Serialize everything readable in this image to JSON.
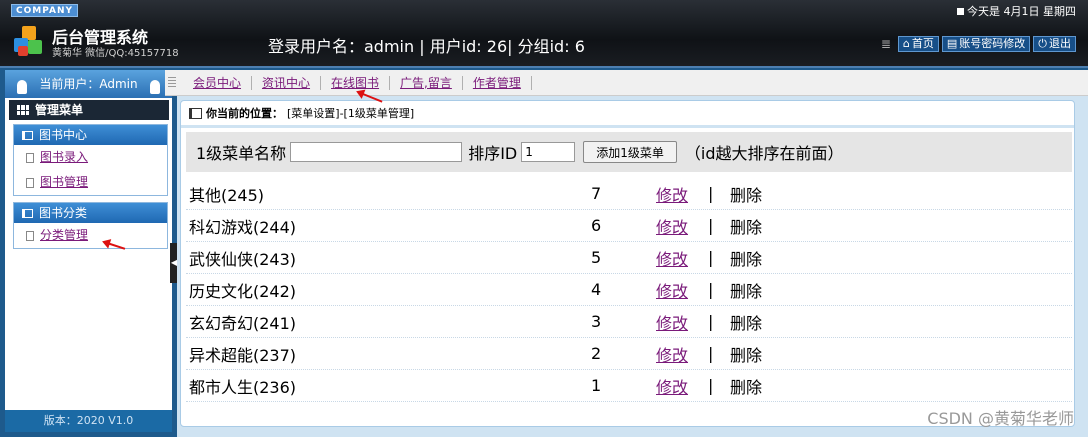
{
  "header": {
    "company": "COMPANY",
    "system_title": "后台管理系统",
    "system_subtitle": "黄菊华 微信/QQ:45157718",
    "login_info": "登录用户名：admin | 用户id: 26| 分组id: 6",
    "date_text": "今天是 4月1日 星期四",
    "buttons": [
      {
        "label": "首页",
        "icon": "home-icon"
      },
      {
        "label": "账号密码修改",
        "icon": "edit-icon"
      },
      {
        "label": "退出",
        "icon": "power-icon"
      }
    ]
  },
  "sidebar": {
    "current_user": "当前用户：Admin",
    "menu_title": "管理菜单",
    "groups": [
      {
        "title": "图书中心",
        "items": [
          "图书录入",
          "图书管理"
        ]
      },
      {
        "title": "图书分类",
        "items": [
          "分类管理"
        ]
      }
    ],
    "version": "版本：2020 V1.0"
  },
  "topnav": {
    "tabs": [
      "会员中心",
      "资讯中心",
      "在线图书",
      "广告,留言",
      "作者管理"
    ]
  },
  "main": {
    "location_label": "你当前的位置：",
    "location_path": "[菜单设置]-[1级菜单管理]",
    "form": {
      "name_label": "1级菜单名称",
      "name_value": "",
      "sort_label": "排序ID",
      "sort_value": "1",
      "add_button": "添加1级菜单",
      "hint": "（id越大排序在前面）"
    },
    "rows": [
      {
        "name": "其他(245)",
        "sort": "7",
        "edit": "修改",
        "sep": "|",
        "delete": "删除"
      },
      {
        "name": "科幻游戏(244)",
        "sort": "6",
        "edit": "修改",
        "sep": "|",
        "delete": "删除"
      },
      {
        "name": "武侠仙侠(243)",
        "sort": "5",
        "edit": "修改",
        "sep": "|",
        "delete": "删除"
      },
      {
        "name": "历史文化(242)",
        "sort": "4",
        "edit": "修改",
        "sep": "|",
        "delete": "删除"
      },
      {
        "name": "玄幻奇幻(241)",
        "sort": "3",
        "edit": "修改",
        "sep": "|",
        "delete": "删除"
      },
      {
        "name": "异术超能(237)",
        "sort": "2",
        "edit": "修改",
        "sep": "|",
        "delete": "删除"
      },
      {
        "name": "都市人生(236)",
        "sort": "1",
        "edit": "修改",
        "sep": "|",
        "delete": "删除"
      }
    ]
  },
  "watermark": "CSDN @黄菊华老师"
}
